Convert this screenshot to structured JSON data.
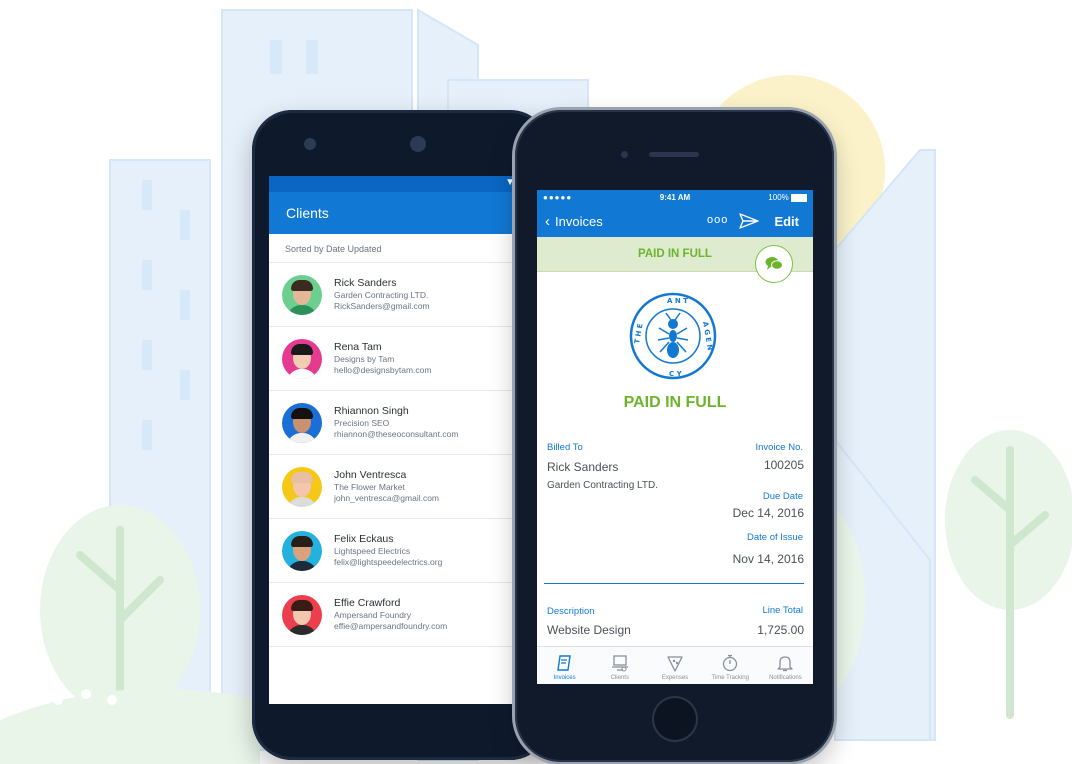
{
  "android": {
    "app_title": "Clients",
    "sort_label": "Sorted by Date Updated",
    "clients": [
      {
        "name": "Rick Sanders",
        "company": "Garden Contracting LTD.",
        "email": "RickSanders@gmail.com",
        "avatar_bg": "#6ccf8f",
        "hair": "#3b2a20",
        "skin": "#e5b797",
        "shirt": "#2d8f5a"
      },
      {
        "name": "Rena Tam",
        "company": "Designs by Tam",
        "email": "hello@designsbytam.com",
        "avatar_bg": "#e43a8f",
        "hair": "#1a1a1a",
        "skin": "#f1cdb4",
        "shirt": "#ffffff"
      },
      {
        "name": "Rhiannon Singh",
        "company": "Precision SEO",
        "email": "rhiannon@theseoconsultant.com",
        "avatar_bg": "#1a6fd6",
        "hair": "#15110e",
        "skin": "#c9916f",
        "shirt": "#f0f0f0"
      },
      {
        "name": "John Ventresca",
        "company": "The Flower Market",
        "email": "john_ventresca@gmail.com",
        "avatar_bg": "#f5c816",
        "hair": "#e8bfa5",
        "skin": "#f2c7ad",
        "shirt": "#dcdcdc"
      },
      {
        "name": "Felix Eckaus",
        "company": "Lightspeed Electrics",
        "email": "felix@lightspeedelectrics.org",
        "avatar_bg": "#23b2dd",
        "hair": "#2a1f18",
        "skin": "#d9a27d",
        "shirt": "#1c2a3a"
      },
      {
        "name": "Effie Crawford",
        "company": "Ampersand Foundry",
        "email": "effie@ampersandfoundry.com",
        "avatar_bg": "#ec3e4c",
        "hair": "#3a1c16",
        "skin": "#f3c8b0",
        "shirt": "#2b2b2b"
      }
    ]
  },
  "iphone": {
    "status": {
      "signal": "●●●●● ",
      "time": "9:41 AM",
      "battery": "100%"
    },
    "nav": {
      "back_label": "Invoices",
      "more_label": "ooo",
      "edit_label": "Edit"
    },
    "banner_text": "PAID IN FULL",
    "logo_text": "THE ANT AGENCY",
    "paid_status": "PAID IN FULL",
    "billed_to_label": "Billed To",
    "client_name": "Rick Sanders",
    "client_company": "Garden Contracting LTD.",
    "invoice_no_label": "Invoice No.",
    "invoice_no": "100205",
    "due_date_label": "Due Date",
    "due_date": "Dec 14, 2016",
    "issue_date_label": "Date of Issue",
    "issue_date": "Nov 14, 2016",
    "description_label": "Description",
    "description": "Website Design",
    "line_total_label": "Line Total",
    "line_total": "1,725.00",
    "tabs": [
      {
        "label": "Invoices",
        "icon": "invoice-icon"
      },
      {
        "label": "Clients",
        "icon": "clients-icon"
      },
      {
        "label": "Expenses",
        "icon": "expenses-icon"
      },
      {
        "label": "Time Tracking",
        "icon": "stopwatch-icon"
      },
      {
        "label": "Notifications",
        "icon": "bell-icon"
      }
    ]
  },
  "colors": {
    "brand_blue": "#1178d3",
    "paid_green": "#6cb52b",
    "banner_bg": "#deebcf"
  }
}
